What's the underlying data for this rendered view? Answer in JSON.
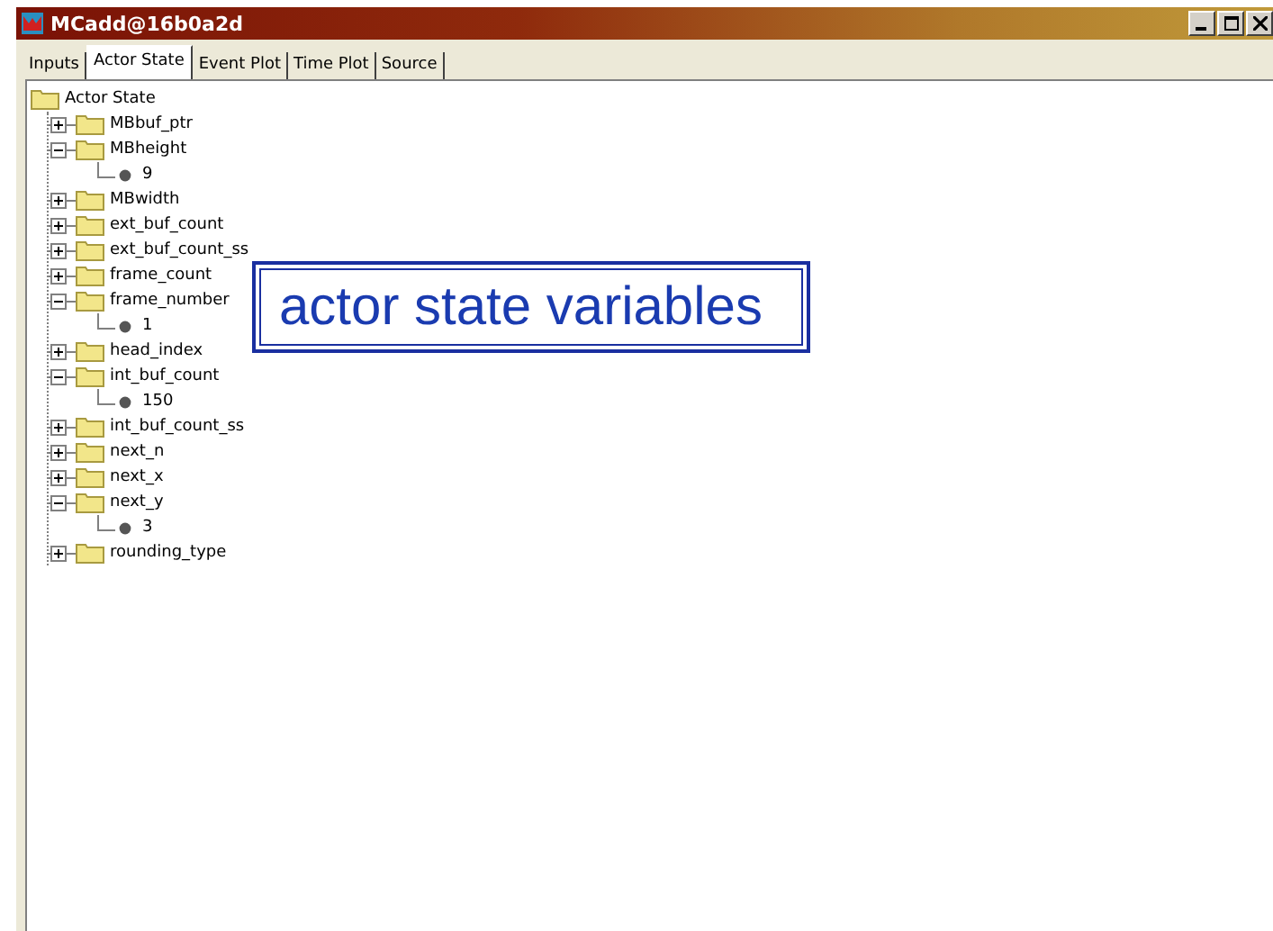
{
  "window": {
    "title": "MCadd@16b0a2d"
  },
  "tabs": [
    {
      "label": "Inputs",
      "selected": false
    },
    {
      "label": "Actor State",
      "selected": true
    },
    {
      "label": "Event Plot",
      "selected": false
    },
    {
      "label": "Time Plot",
      "selected": false
    },
    {
      "label": "Source",
      "selected": false
    }
  ],
  "tree": {
    "label": "Actor State",
    "children": [
      {
        "label": "MBbuf_ptr",
        "expanded": false
      },
      {
        "label": "MBheight",
        "expanded": true,
        "children": [
          {
            "label": "9"
          }
        ]
      },
      {
        "label": "MBwidth",
        "expanded": false
      },
      {
        "label": "ext_buf_count",
        "expanded": false
      },
      {
        "label": "ext_buf_count_ss",
        "expanded": false
      },
      {
        "label": "frame_count",
        "expanded": false
      },
      {
        "label": "frame_number",
        "expanded": true,
        "children": [
          {
            "label": "1"
          }
        ]
      },
      {
        "label": "head_index",
        "expanded": false
      },
      {
        "label": "int_buf_count",
        "expanded": true,
        "children": [
          {
            "label": "150"
          }
        ]
      },
      {
        "label": "int_buf_count_ss",
        "expanded": false
      },
      {
        "label": "next_n",
        "expanded": false
      },
      {
        "label": "next_x",
        "expanded": false
      },
      {
        "label": "next_y",
        "expanded": true,
        "children": [
          {
            "label": "3"
          }
        ]
      },
      {
        "label": "rounding_type",
        "expanded": false
      }
    ]
  },
  "callout": {
    "text": "actor state variables"
  }
}
